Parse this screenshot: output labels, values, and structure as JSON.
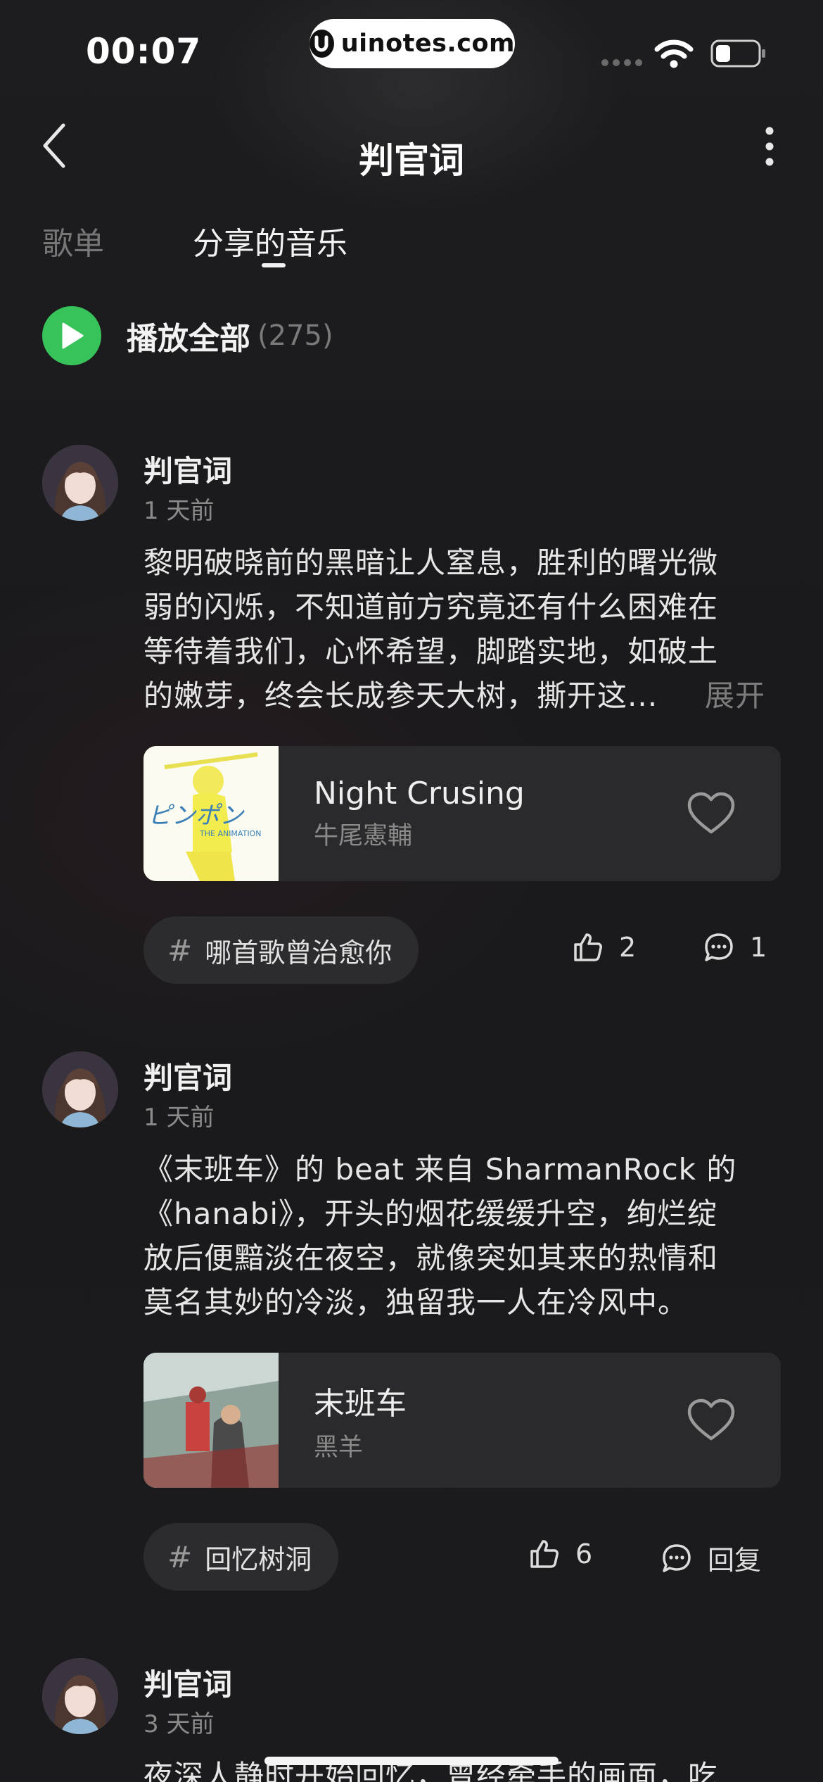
{
  "status_bar": {
    "time": "00:07",
    "watermark": "uinotes.com"
  },
  "header": {
    "title": "判官词"
  },
  "tabs": [
    {
      "label": "歌单",
      "active": false
    },
    {
      "label": "分享的音乐",
      "active": true
    }
  ],
  "play_all": {
    "label": "播放全部",
    "count": "(275)"
  },
  "posts": [
    {
      "author": "判官词",
      "time": "1 天前",
      "lines": [
        "黎明破晓前的黑暗让人窒息，胜利的曙光微",
        "弱的闪烁，不知道前方究竟还有什么困难在",
        "等待着我们，心怀希望，脚踏实地，如破土",
        "的嫩芽，终会长成参天大树，撕开这..."
      ],
      "expand": "展开",
      "song": {
        "title": "Night Crusing",
        "artist": "牛尾憲輔",
        "cover_text": "ピンポン THE ANIMATION"
      },
      "tag": "哪首歌曾治愈你",
      "likes": "2",
      "comments": "1"
    },
    {
      "author": "判官词",
      "time": "1 天前",
      "lines": [
        "《末班车》的 beat 来自 SharmanRock 的",
        "《hanabi》，开头的烟花缓缓升空，绚烂绽",
        "放后便黯淡在夜空，就像突如其来的热情和",
        "莫名其妙的冷淡，独留我一人在冷风中。"
      ],
      "song": {
        "title": "末班车",
        "artist": "黑羊"
      },
      "tag": "回忆树洞",
      "likes": "6",
      "comments": "回复"
    },
    {
      "author": "判官词",
      "time": "3 天前",
      "lines": [
        "夜深人静时开始回忆，曾经牵手的画面，吃"
      ]
    }
  ],
  "colors": {
    "background": "#1c1c1e",
    "accent_green": "#37c35a",
    "card": "#2a2a2c"
  },
  "icons": [
    "back-chevron-icon",
    "more-vertical-icon",
    "play-icon",
    "heart-icon",
    "hash-icon",
    "thumbs-up-icon",
    "comment-icon",
    "wifi-icon",
    "battery-icon"
  ]
}
